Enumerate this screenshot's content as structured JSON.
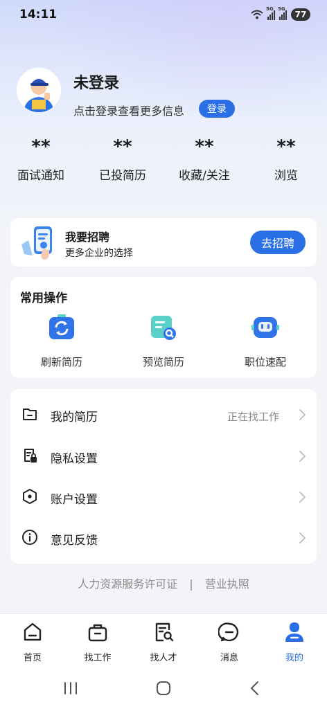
{
  "status_bar": {
    "time": "14:11",
    "signal_1": "5G",
    "signal_2": "5G",
    "battery": "77"
  },
  "profile": {
    "name": "未登录",
    "hint": "点击登录查看更多信息",
    "login_label": "登录"
  },
  "stats": [
    {
      "value": "**",
      "label": "面试通知"
    },
    {
      "value": "**",
      "label": "已投简历"
    },
    {
      "value": "**",
      "label": "收藏/关注"
    },
    {
      "value": "**",
      "label": "浏览"
    }
  ],
  "recruit": {
    "title": "我要招聘",
    "subtitle": "更多企业的选择",
    "button": "去招聘"
  },
  "actions": {
    "title": "常用操作",
    "items": [
      {
        "label": "刷新简历",
        "icon": "refresh-resume-icon"
      },
      {
        "label": "预览简历",
        "icon": "preview-resume-icon"
      },
      {
        "label": "职位速配",
        "icon": "job-match-robot-icon"
      }
    ]
  },
  "menu": [
    {
      "label": "我的简历",
      "status": "正在找工作",
      "icon": "folder-icon"
    },
    {
      "label": "隐私设置",
      "status": "",
      "icon": "privacy-lock-icon"
    },
    {
      "label": "账户设置",
      "status": "",
      "icon": "hexagon-settings-icon"
    },
    {
      "label": "意见反馈",
      "status": "",
      "icon": "info-icon"
    }
  ],
  "footer": {
    "license": "人力资源服务许可证",
    "separator": "|",
    "business": "营业执照"
  },
  "tabs": [
    {
      "label": "首页",
      "icon": "home-icon"
    },
    {
      "label": "找工作",
      "icon": "briefcase-icon"
    },
    {
      "label": "找人才",
      "icon": "talent-search-icon"
    },
    {
      "label": "消息",
      "icon": "message-icon"
    },
    {
      "label": "我的",
      "icon": "profile-icon",
      "active": true
    }
  ],
  "colors": {
    "accent": "#2b6fe6",
    "muted": "#8a8a8a"
  }
}
